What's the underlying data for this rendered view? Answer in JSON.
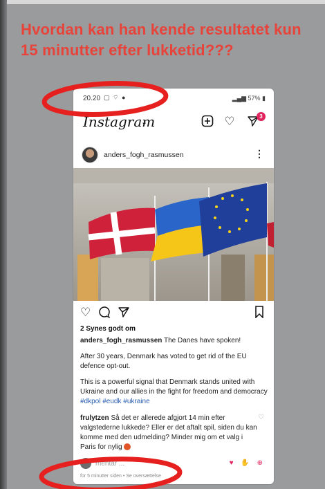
{
  "headline": "Hvordan kan han kende resultatet kun 15 minutter efter lukketid???",
  "statusbar": {
    "time": "20.20",
    "battery": "57%"
  },
  "instagram": {
    "logo": "Instagram",
    "notification_count": "3"
  },
  "post": {
    "username": "anders_fogh_rasmussen",
    "likes": "2 Synes godt om",
    "caption_user": "anders_fogh_rasmussen",
    "caption_lead": "The Danes have spoken!",
    "paragraph_2": "After 30 years, Denmark has voted to get rid of the EU defence opt-out.",
    "paragraph_3": "This is a powerful signal that Denmark stands united with Ukraine and our allies in the fight for freedom and democracy",
    "hashtags": "#dkpol #eudk #ukraine"
  },
  "comment": {
    "user": "frulytzen",
    "text": "Så det er allerede afgjort 14 min efter valgstederne lukkede? Eller er det  aftalt spil, siden du kan komme med den udmelding? Minder mig om et valg i Paris for nylig"
  },
  "add_comment": {
    "placeholder": "mentar ..."
  },
  "timestamp": "for 5 minutter siden • Se oversættelse",
  "colors": {
    "headline": "#e8433a",
    "annotation": "#e6201e",
    "flag_denmark": "#d0213a",
    "flag_eu": "#1f3f9a",
    "flag_ukraine_blue": "#2a66c9",
    "flag_ukraine_yellow": "#f5c518"
  }
}
